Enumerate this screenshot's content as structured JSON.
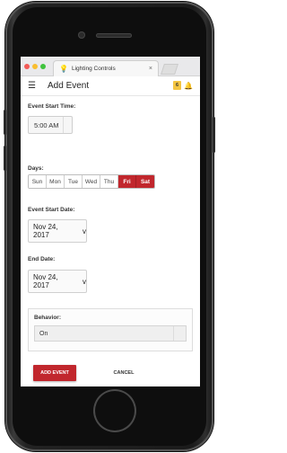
{
  "browser": {
    "tab_title": "Lighting Controls",
    "tab_icon": "lightbulb-icon",
    "close_glyph": "×"
  },
  "header": {
    "title": "Add Event",
    "badge": "6",
    "menu_icon": "hamburger-menu-icon",
    "bell_icon": "bell-icon"
  },
  "form": {
    "start_time": {
      "label": "Event Start Time:",
      "value": "5:00 AM"
    },
    "days": {
      "label": "Days:",
      "items": [
        {
          "label": "Sun",
          "selected": false
        },
        {
          "label": "Mon",
          "selected": false
        },
        {
          "label": "Tue",
          "selected": false
        },
        {
          "label": "Wed",
          "selected": false
        },
        {
          "label": "Thu",
          "selected": false
        },
        {
          "label": "Fri",
          "selected": true
        },
        {
          "label": "Sat",
          "selected": true
        }
      ]
    },
    "start_date": {
      "label": "Event Start Date:",
      "value": "Nov 24, 2017",
      "toggle": "v"
    },
    "end_date": {
      "label": "End Date:",
      "value": "Nov 24, 2017",
      "toggle": "v"
    },
    "behavior": {
      "label": "Behavior:",
      "value": "On"
    }
  },
  "actions": {
    "add_label": "ADD EVENT",
    "cancel_label": "CANCEL"
  },
  "colors": {
    "accent": "#c1272d",
    "badge": "#f4c542"
  }
}
